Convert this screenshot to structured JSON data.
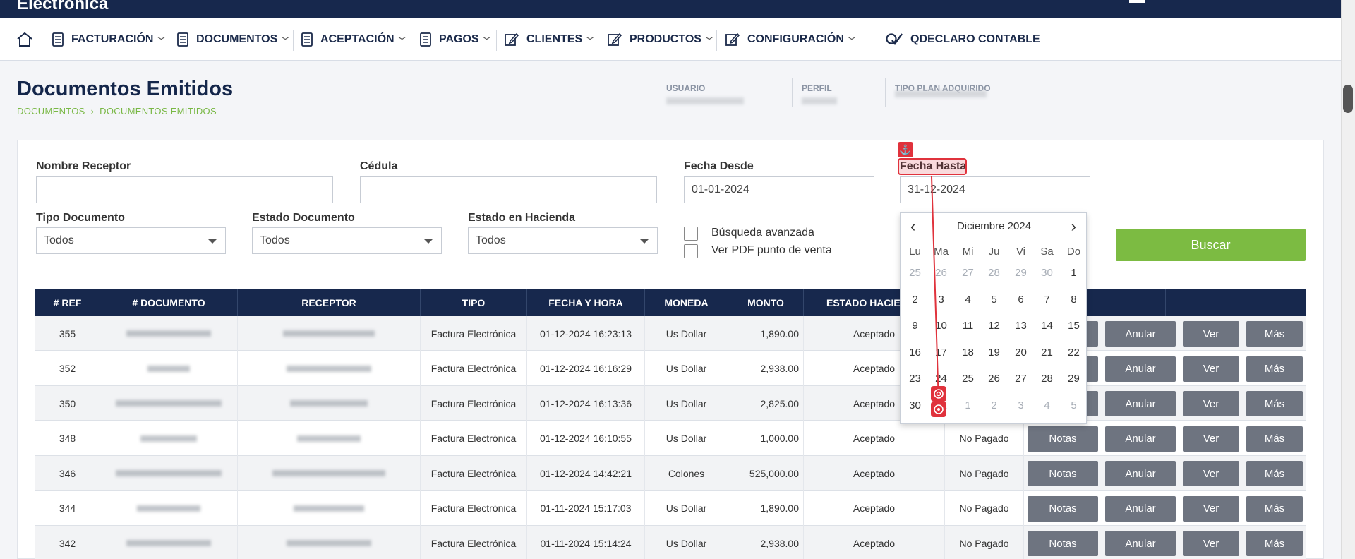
{
  "brand": {
    "name": "Electronica"
  },
  "nav": {
    "items": [
      {
        "label": "FACTURACIÓN"
      },
      {
        "label": "DOCUMENTOS"
      },
      {
        "label": "ACEPTACIÓN"
      },
      {
        "label": "PAGOS"
      },
      {
        "label": "CLIENTES"
      },
      {
        "label": "PRODUCTOS"
      },
      {
        "label": "CONFIGURACIÓN"
      },
      {
        "label": "QDECLARO CONTABLE"
      }
    ]
  },
  "page": {
    "title": "Documentos Emitidos",
    "breadcrumb": [
      "DOCUMENTOS",
      "DOCUMENTOS EMITIDOS"
    ],
    "breadcrumb_sep": "›"
  },
  "info": {
    "usuario": "USUARIO",
    "perfil": "PERFIL",
    "tipo_plan": "TIPO PLAN ADQUIRIDO"
  },
  "filters": {
    "nombre_receptor": {
      "label": "Nombre Receptor",
      "value": ""
    },
    "cedula": {
      "label": "Cédula",
      "value": ""
    },
    "fecha_desde": {
      "label": "Fecha Desde",
      "value": "01-01-2024"
    },
    "fecha_hasta": {
      "label": "Fecha Hasta",
      "value": "31-12-2024"
    },
    "tipo_documento": {
      "label": "Tipo Documento",
      "value": "Todos"
    },
    "estado_documento": {
      "label": "Estado Documento",
      "value": "Todos"
    },
    "estado_hacienda": {
      "label": "Estado en Hacienda",
      "value": "Todos"
    },
    "busqueda_avanzada": "Búsqueda avanzada",
    "ver_pdf": "Ver PDF punto de venta",
    "buscar": "Buscar"
  },
  "calendar": {
    "month_label": "Diciembre 2024",
    "prev": "‹",
    "next": "›",
    "dow": [
      "Lu",
      "Ma",
      "Mi",
      "Ju",
      "Vi",
      "Sa",
      "Do"
    ],
    "weeks": [
      [
        "25",
        "26",
        "27",
        "28",
        "29",
        "30",
        "1"
      ],
      [
        "2",
        "3",
        "4",
        "5",
        "6",
        "7",
        "8"
      ],
      [
        "9",
        "10",
        "11",
        "12",
        "13",
        "14",
        "15"
      ],
      [
        "16",
        "17",
        "18",
        "19",
        "20",
        "21",
        "22"
      ],
      [
        "23",
        "24",
        "25",
        "26",
        "27",
        "28",
        "29"
      ],
      [
        "30",
        "31",
        "1",
        "2",
        "3",
        "4",
        "5"
      ]
    ],
    "muted": [
      [
        true,
        true,
        true,
        true,
        true,
        true,
        false
      ],
      [
        false,
        false,
        false,
        false,
        false,
        false,
        false
      ],
      [
        false,
        false,
        false,
        false,
        false,
        false,
        false
      ],
      [
        false,
        false,
        false,
        false,
        false,
        false,
        false
      ],
      [
        false,
        false,
        false,
        false,
        false,
        false,
        false
      ],
      [
        false,
        false,
        true,
        true,
        true,
        true,
        true
      ]
    ]
  },
  "table": {
    "headers": [
      "# REF",
      "# DOCUMENTO",
      "RECEPTOR",
      "TIPO",
      "FECHA Y HORA",
      "MONEDA",
      "MONTO",
      "ESTADO HACIENDA",
      "",
      "",
      "",
      "",
      ""
    ],
    "actions": {
      "notas": "Notas",
      "anular": "Anular",
      "ver": "Ver",
      "mas": "Más"
    },
    "rows": [
      {
        "ref": "355",
        "tipo": "Factura Electrónica",
        "fecha": "01-12-2024 16:23:13",
        "moneda": "Us Dollar",
        "monto": "1,890.00",
        "estado": "Aceptado",
        "pago": ""
      },
      {
        "ref": "352",
        "tipo": "Factura Electrónica",
        "fecha": "01-12-2024 16:16:29",
        "moneda": "Us Dollar",
        "monto": "2,938.00",
        "estado": "Aceptado",
        "pago": ""
      },
      {
        "ref": "350",
        "tipo": "Factura Electrónica",
        "fecha": "01-12-2024 16:13:36",
        "moneda": "Us Dollar",
        "monto": "2,825.00",
        "estado": "Aceptado",
        "pago": ""
      },
      {
        "ref": "348",
        "tipo": "Factura Electrónica",
        "fecha": "01-12-2024 16:10:55",
        "moneda": "Us Dollar",
        "monto": "1,000.00",
        "estado": "Aceptado",
        "pago": "No Pagado"
      },
      {
        "ref": "346",
        "tipo": "Factura Electrónica",
        "fecha": "01-12-2024 14:42:21",
        "moneda": "Colones",
        "monto": "525,000.00",
        "estado": "Aceptado",
        "pago": "No Pagado"
      },
      {
        "ref": "344",
        "tipo": "Factura Electrónica",
        "fecha": "01-11-2024 15:17:03",
        "moneda": "Us Dollar",
        "monto": "1,890.00",
        "estado": "Aceptado",
        "pago": "No Pagado"
      },
      {
        "ref": "342",
        "tipo": "Factura Electrónica",
        "fecha": "01-11-2024 15:14:24",
        "moneda": "Us Dollar",
        "monto": "2,938.00",
        "estado": "Aceptado",
        "pago": "No Pagado"
      }
    ]
  },
  "colors": {
    "navy": "#17284d",
    "green": "#7cbb42",
    "gray_button": "#6e7480",
    "highlight": "#e0323c"
  }
}
